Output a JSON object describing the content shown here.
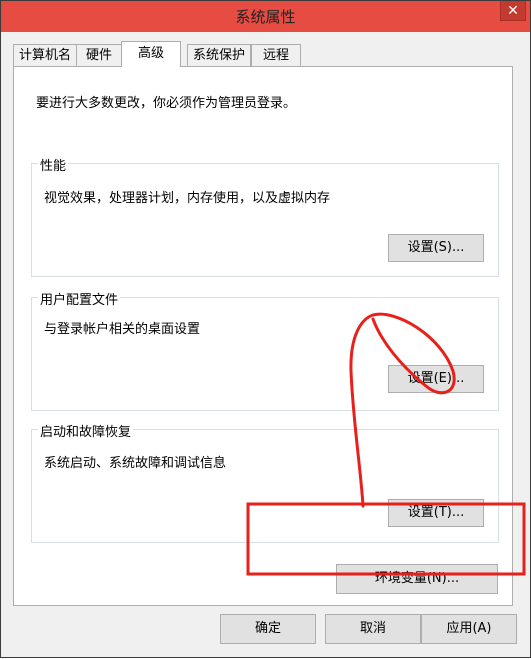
{
  "window": {
    "title": "系统属性",
    "close_symbol": "✕"
  },
  "tabs": [
    {
      "label": "计算机名"
    },
    {
      "label": "硬件"
    },
    {
      "label": "高级"
    },
    {
      "label": "系统保护"
    },
    {
      "label": "远程"
    }
  ],
  "advanced": {
    "admin_note": "要进行大多数更改，你必须作为管理员登录。",
    "performance": {
      "legend": "性能",
      "description": "视觉效果，处理器计划，内存使用，以及虚拟内存",
      "button": "设置(S)..."
    },
    "user_profiles": {
      "legend": "用户配置文件",
      "description": "与登录帐户相关的桌面设置",
      "button": "设置(E)..."
    },
    "startup_recovery": {
      "legend": "启动和故障恢复",
      "description": "系统启动、系统故障和调试信息",
      "button": "设置(T)..."
    },
    "env_button": "环境变量(N)..."
  },
  "footer": {
    "ok": "确定",
    "cancel": "取消",
    "apply": "应用(A)"
  },
  "colors": {
    "titlebar": "#e64c41",
    "annotation_red": "#e8201b"
  }
}
